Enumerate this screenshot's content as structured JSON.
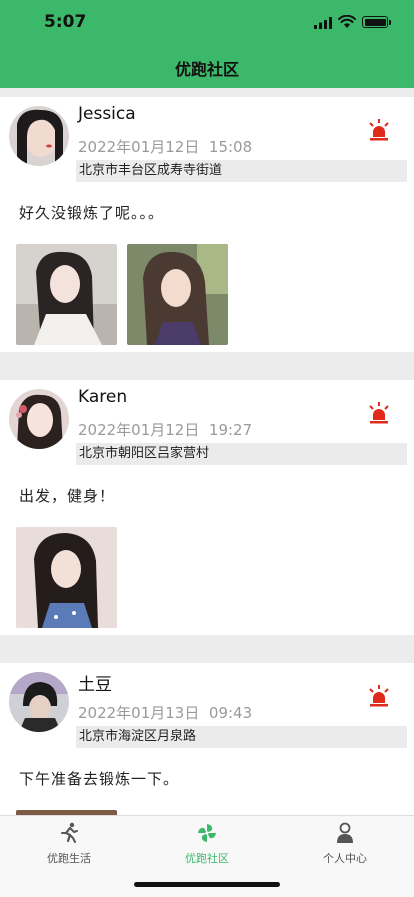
{
  "status_bar": {
    "time": "5:07"
  },
  "nav": {
    "title": "优跑社区"
  },
  "posts": [
    {
      "name": "Jessica",
      "date": "2022年01月12日",
      "time": "15:08",
      "location": "北京市丰台区成寿寺街道",
      "content": "好久没锻炼了呢。。。",
      "photo_count": 2
    },
    {
      "name": "Karen",
      "date": "2022年01月12日",
      "time": "19:27",
      "location": "北京市朝阳区吕家营村",
      "content": "出发，健身！",
      "photo_count": 1
    },
    {
      "name": "土豆",
      "date": "2022年01月13日",
      "time": "09:43",
      "location": "北京市海淀区月泉路",
      "content": "下午准备去锻炼一下。",
      "photo_count": 1
    }
  ],
  "tabs": [
    {
      "label": "优跑生活",
      "icon": "runner-icon",
      "active": false
    },
    {
      "label": "优跑社区",
      "icon": "pinwheel-icon",
      "active": true
    },
    {
      "label": "个人中心",
      "icon": "person-icon",
      "active": false
    }
  ],
  "colors": {
    "accent": "#3cb86a",
    "alarm": "#e02a1c",
    "location_bg": "#ebebeb"
  }
}
